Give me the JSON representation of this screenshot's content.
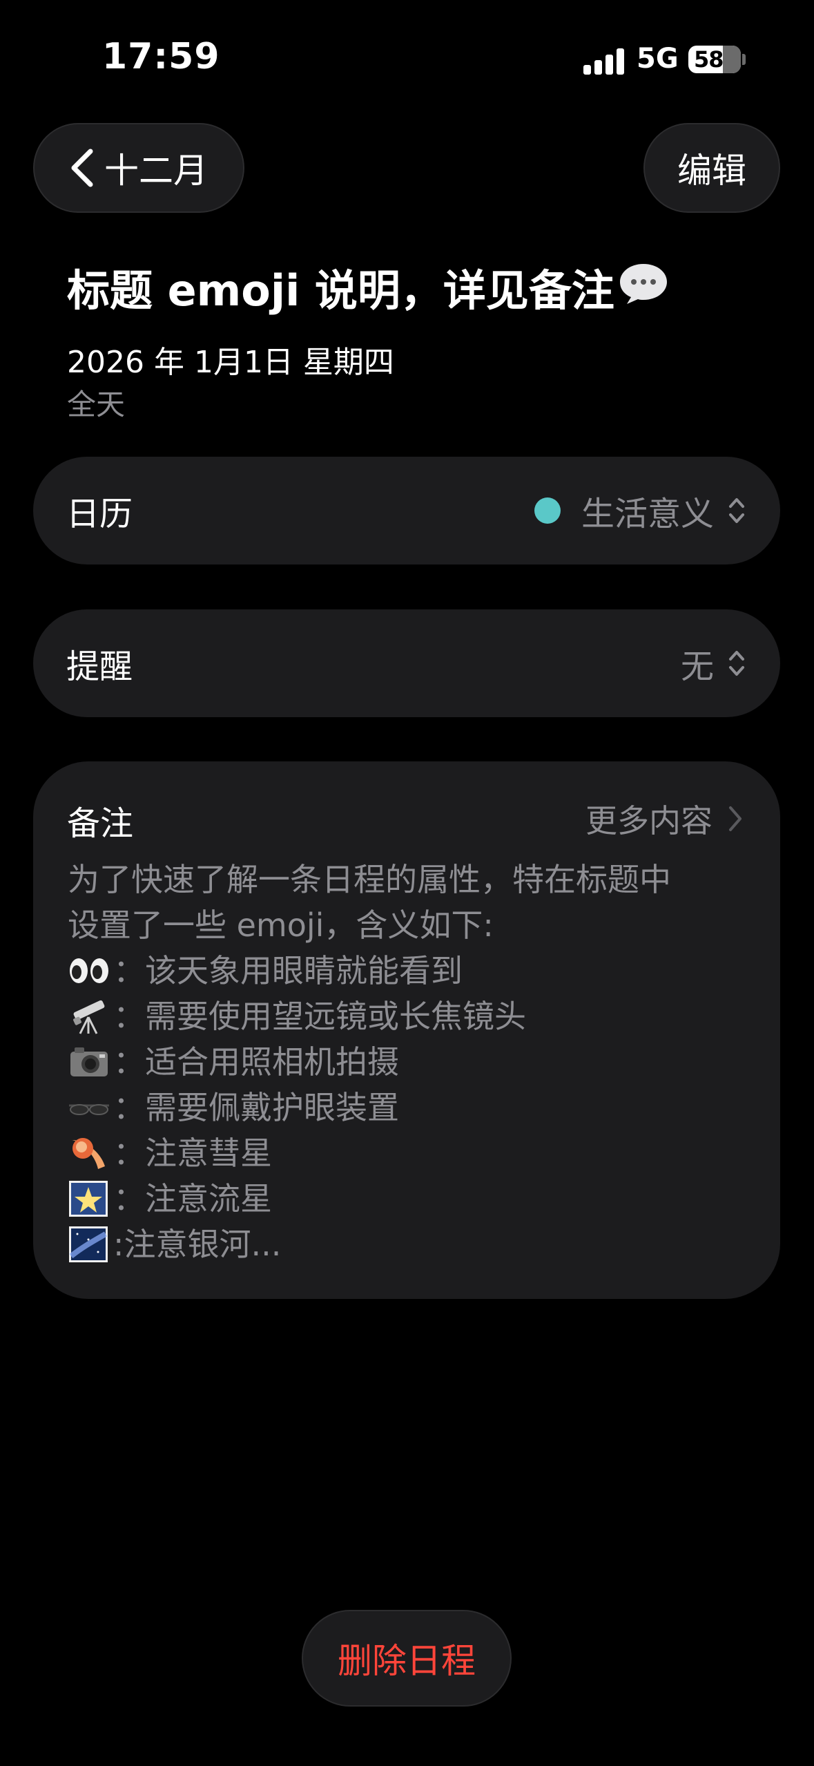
{
  "status_bar": {
    "time": "17:59",
    "network": "5G",
    "battery": "58"
  },
  "nav": {
    "back_label": "十二月",
    "edit_label": "编辑"
  },
  "event": {
    "title": "标题 emoji 说明，详见备注",
    "title_icon": "speech-bubble-icon",
    "date": "2026 年 1月1日  星期四",
    "all_day": "全天"
  },
  "calendar_row": {
    "label": "日历",
    "value": "生活意义",
    "color": "#5ac8c8"
  },
  "reminder_row": {
    "label": "提醒",
    "value": "无"
  },
  "notes": {
    "label": "备注",
    "more": "更多内容",
    "intro_line1": "为了快速了解一条日程的属性，特在标题中",
    "intro_line2": "设置了一些 emoji，含义如下:",
    "items": [
      {
        "icon": "eyes-icon",
        "text": "：该天象用眼睛就能看到"
      },
      {
        "icon": "telescope-icon",
        "text": "：需要使用望远镜或长焦镜头"
      },
      {
        "icon": "camera-icon",
        "text": "：适合用照相机拍摄"
      },
      {
        "icon": "sunglasses-icon",
        "text": "：需要佩戴护眼装置"
      },
      {
        "icon": "comet-icon",
        "text": "：注意彗星"
      },
      {
        "icon": "shooting-star-icon",
        "text": "：注意流星"
      },
      {
        "icon": "milky-way-icon",
        "text": ":注意银河..."
      }
    ]
  },
  "delete_label": "删除日程",
  "colors": {
    "background": "#000000",
    "card": "#1c1c1e",
    "secondary_text": "#8e8e93",
    "destructive": "#ff453a"
  }
}
